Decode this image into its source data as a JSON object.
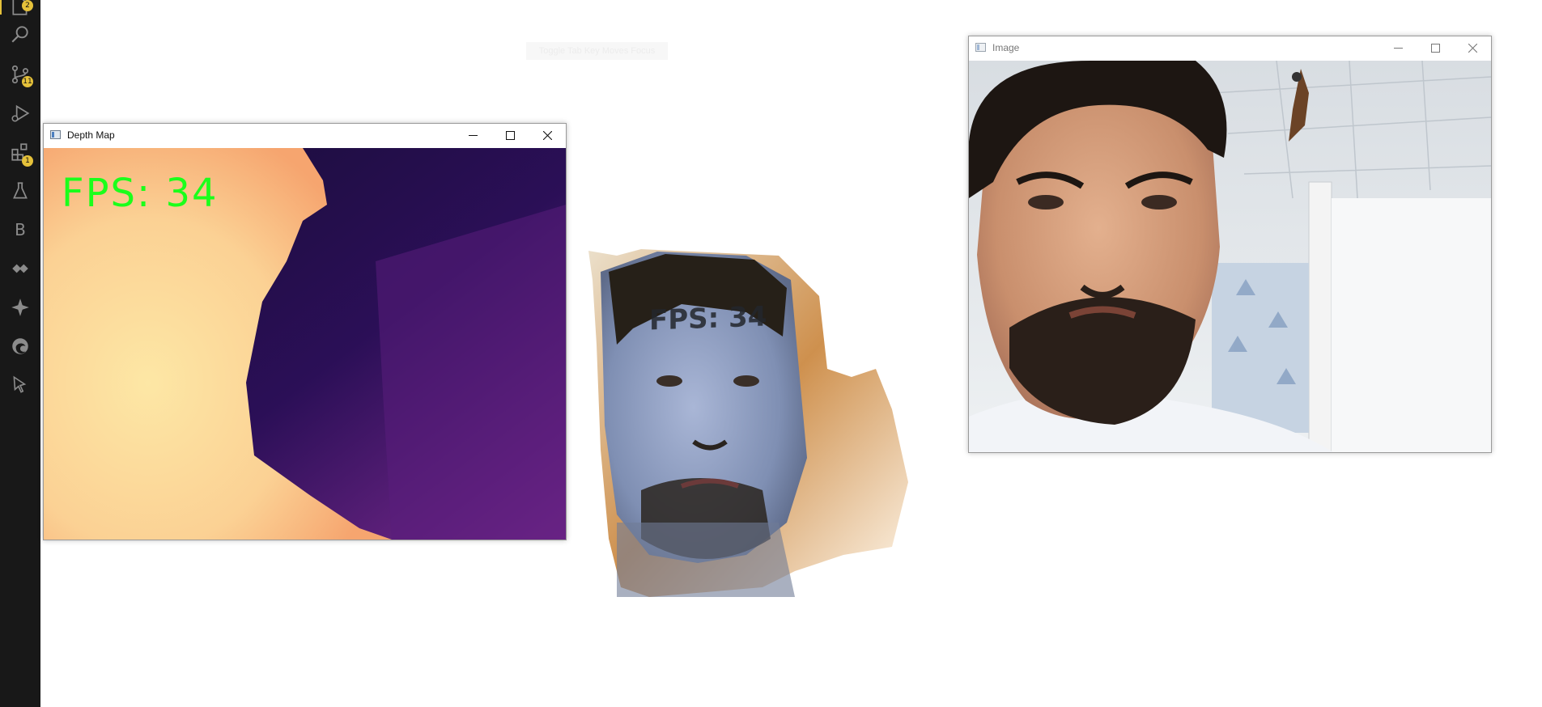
{
  "activity_bar": {
    "explorer_badge": "2",
    "source_control_badge": "11",
    "extensions_badge": "1",
    "b_label": "B"
  },
  "tooltip": {
    "text": "Toggle Tab Key Moves Focus"
  },
  "depth_window": {
    "title": "Depth Map",
    "fps_text": "FPS: 34"
  },
  "point_cloud": {
    "fps_text": "FPS: 34"
  },
  "image_window": {
    "title": "Image"
  },
  "colors": {
    "activity_bar_bg": "#181818",
    "badge": "#e5c13a",
    "fps_green": "#1bff1b"
  }
}
